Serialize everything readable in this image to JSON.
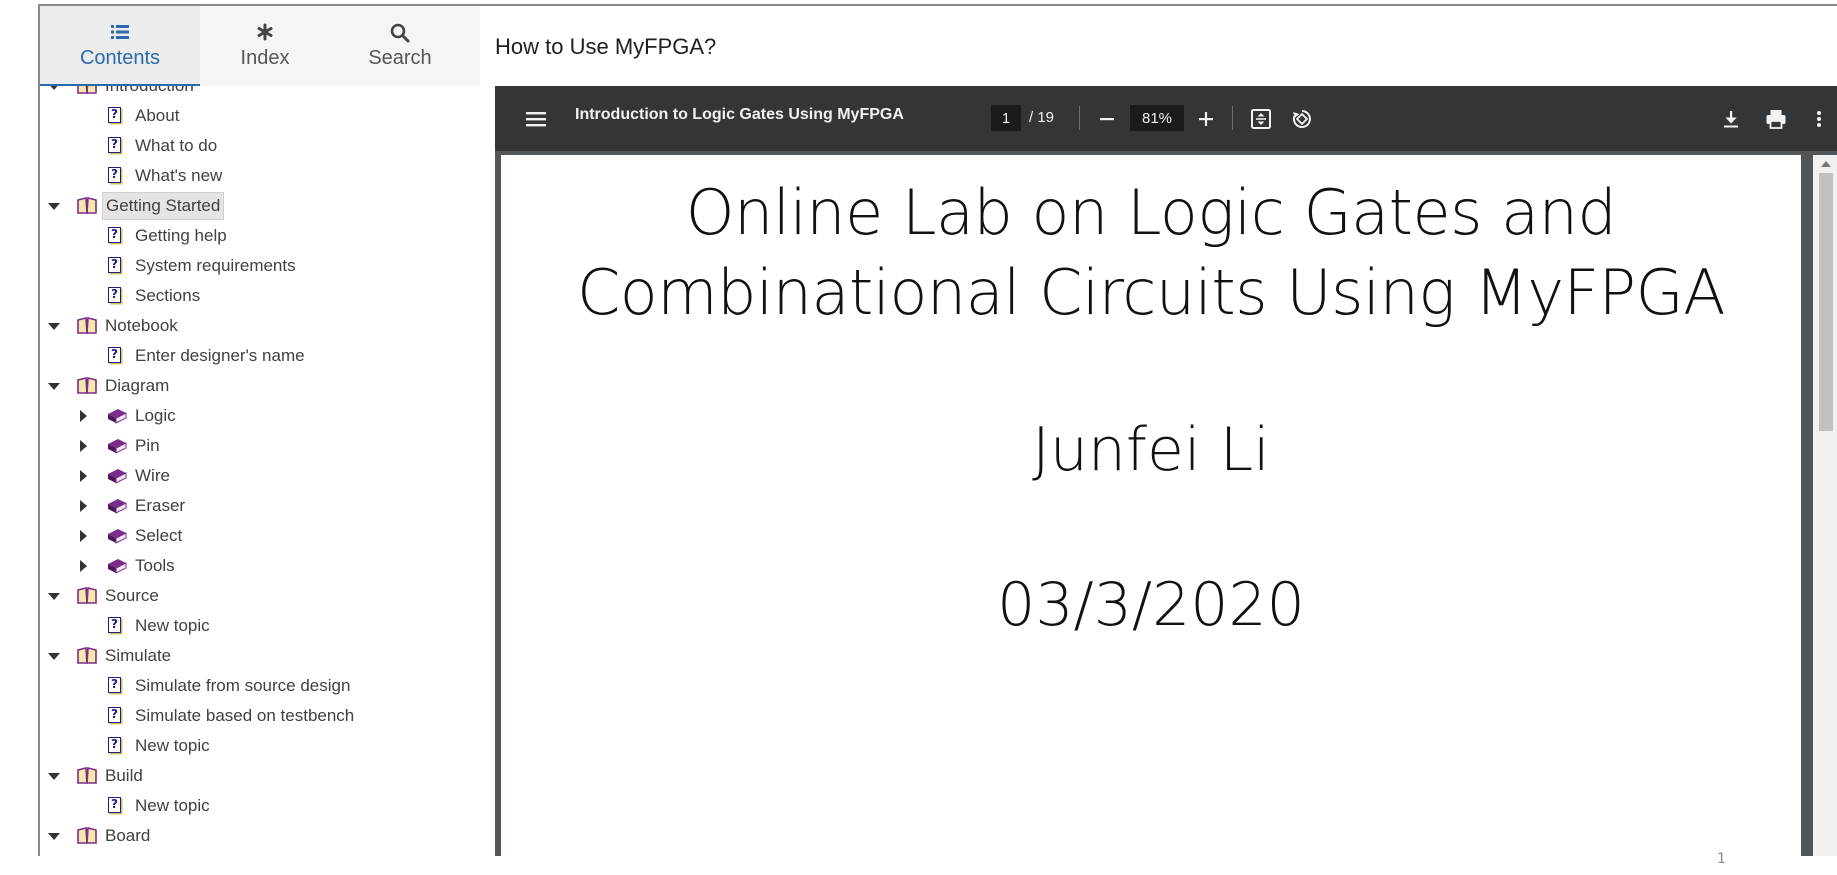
{
  "help_tabs": [
    {
      "label": "Contents",
      "icon": "list-icon"
    },
    {
      "label": "Index",
      "icon": "asterisk-icon"
    },
    {
      "label": "Search",
      "icon": "search-icon"
    }
  ],
  "toc": [
    {
      "label": "Introduction",
      "level": 0,
      "type": "book-open",
      "expanded": true
    },
    {
      "label": "About",
      "level": 1,
      "type": "topic"
    },
    {
      "label": "What to do",
      "level": 1,
      "type": "topic"
    },
    {
      "label": "What's new",
      "level": 1,
      "type": "topic"
    },
    {
      "label": "Getting Started",
      "level": 0,
      "type": "book-open",
      "expanded": true,
      "selected": true
    },
    {
      "label": "Getting help",
      "level": 1,
      "type": "topic"
    },
    {
      "label": "System requirements",
      "level": 1,
      "type": "topic"
    },
    {
      "label": "Sections",
      "level": 1,
      "type": "topic"
    },
    {
      "label": "Notebook",
      "level": 0,
      "type": "book-open",
      "expanded": true
    },
    {
      "label": "Enter designer's name",
      "level": 1,
      "type": "topic"
    },
    {
      "label": "Diagram",
      "level": 0,
      "type": "book-open",
      "expanded": true
    },
    {
      "label": "Logic",
      "level": 1,
      "type": "book-closed",
      "expanded": false
    },
    {
      "label": "Pin",
      "level": 1,
      "type": "book-closed",
      "expanded": false
    },
    {
      "label": "Wire",
      "level": 1,
      "type": "book-closed",
      "expanded": false
    },
    {
      "label": "Eraser",
      "level": 1,
      "type": "book-closed",
      "expanded": false
    },
    {
      "label": "Select",
      "level": 1,
      "type": "book-closed",
      "expanded": false
    },
    {
      "label": "Tools",
      "level": 1,
      "type": "book-closed",
      "expanded": false
    },
    {
      "label": "Source",
      "level": 0,
      "type": "book-open",
      "expanded": true
    },
    {
      "label": "New topic",
      "level": 1,
      "type": "topic"
    },
    {
      "label": "Simulate",
      "level": 0,
      "type": "book-open",
      "expanded": true
    },
    {
      "label": "Simulate from source design",
      "level": 1,
      "type": "topic"
    },
    {
      "label": "Simulate based on testbench",
      "level": 1,
      "type": "topic"
    },
    {
      "label": "New topic",
      "level": 1,
      "type": "topic"
    },
    {
      "label": "Build",
      "level": 0,
      "type": "book-open",
      "expanded": true
    },
    {
      "label": "New topic",
      "level": 1,
      "type": "topic"
    },
    {
      "label": "Board",
      "level": 0,
      "type": "book-open",
      "expanded": true
    }
  ],
  "page_title": "How to Use MyFPGA?",
  "pdf": {
    "doc_title": "Introduction to Logic Gates Using MyFPGA",
    "current_page": "1",
    "total_pages": "/ 19",
    "zoom": "81%",
    "slide": {
      "title_line1": "Online Lab on Logic Gates and",
      "title_line2": "Combinational Circuits Using MyFPGA",
      "author": "Junfei Li",
      "date": "03/3/2020",
      "page_number": "1"
    }
  },
  "colors": {
    "accent": "#2a6aad",
    "toolbar": "#323639",
    "book": "#7b2d8e"
  }
}
